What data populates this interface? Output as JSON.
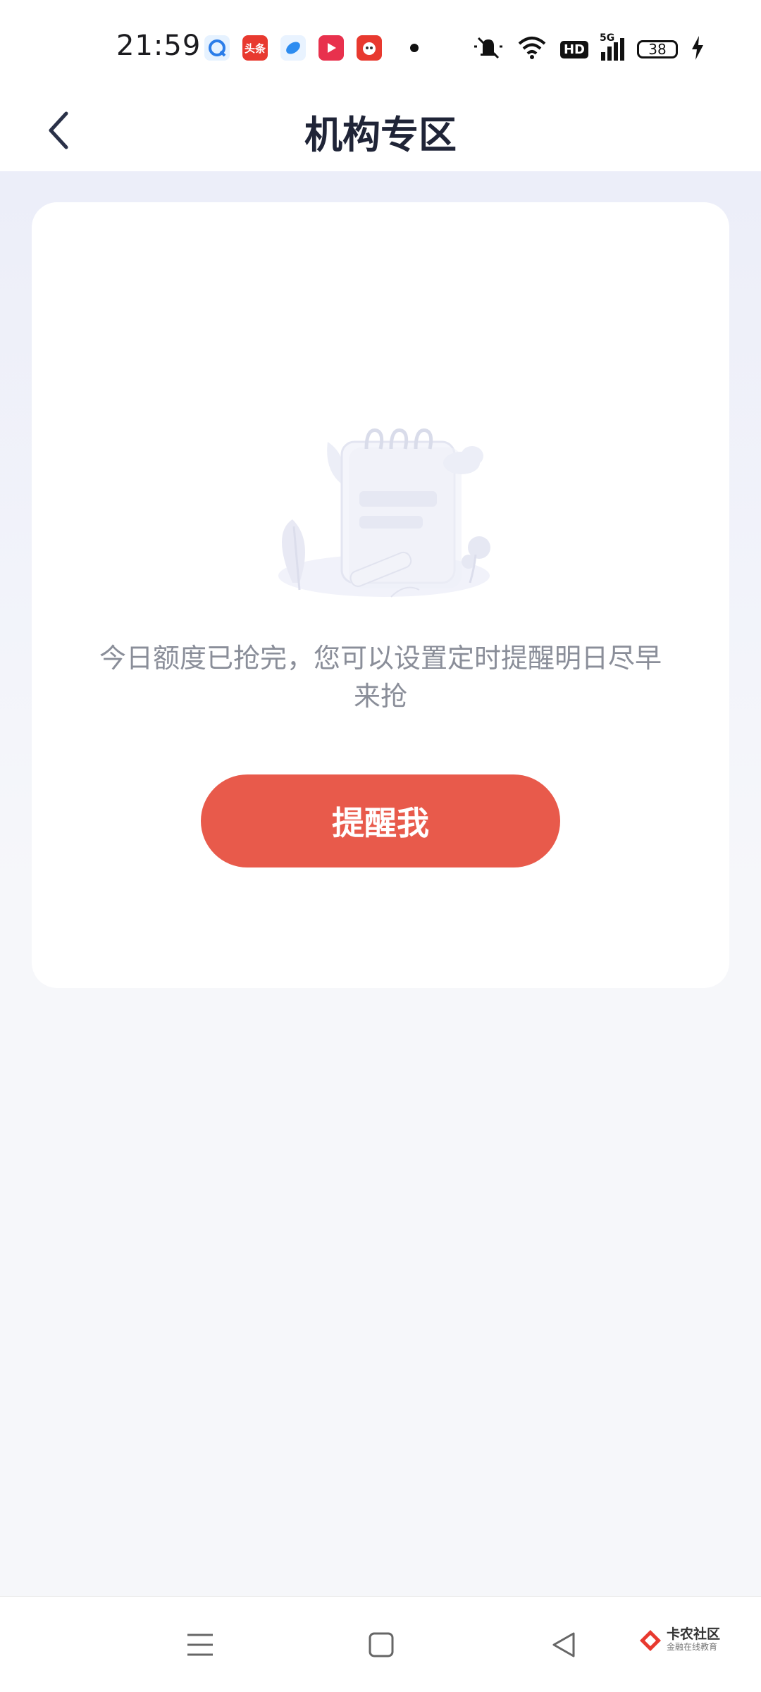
{
  "status_bar": {
    "time": "21:59",
    "battery": "38",
    "network": "5G",
    "hd_label": "HD",
    "notification_icons": [
      "browser-icon",
      "toutiao-icon",
      "app-icon",
      "video-icon",
      "shopping-icon"
    ],
    "toutiao_label": "头条"
  },
  "header": {
    "title": "机构专区"
  },
  "card": {
    "message": "今日额度已抢完，您可以设置定时提醒明日尽早来抢",
    "button_label": "提醒我"
  },
  "watermark": {
    "main": "卡农社区",
    "sub": "金融在线教育"
  },
  "colors": {
    "accent": "#e85a4b",
    "title": "#1f2437",
    "message": "#8a8e99",
    "background": "#f6f7fa"
  }
}
